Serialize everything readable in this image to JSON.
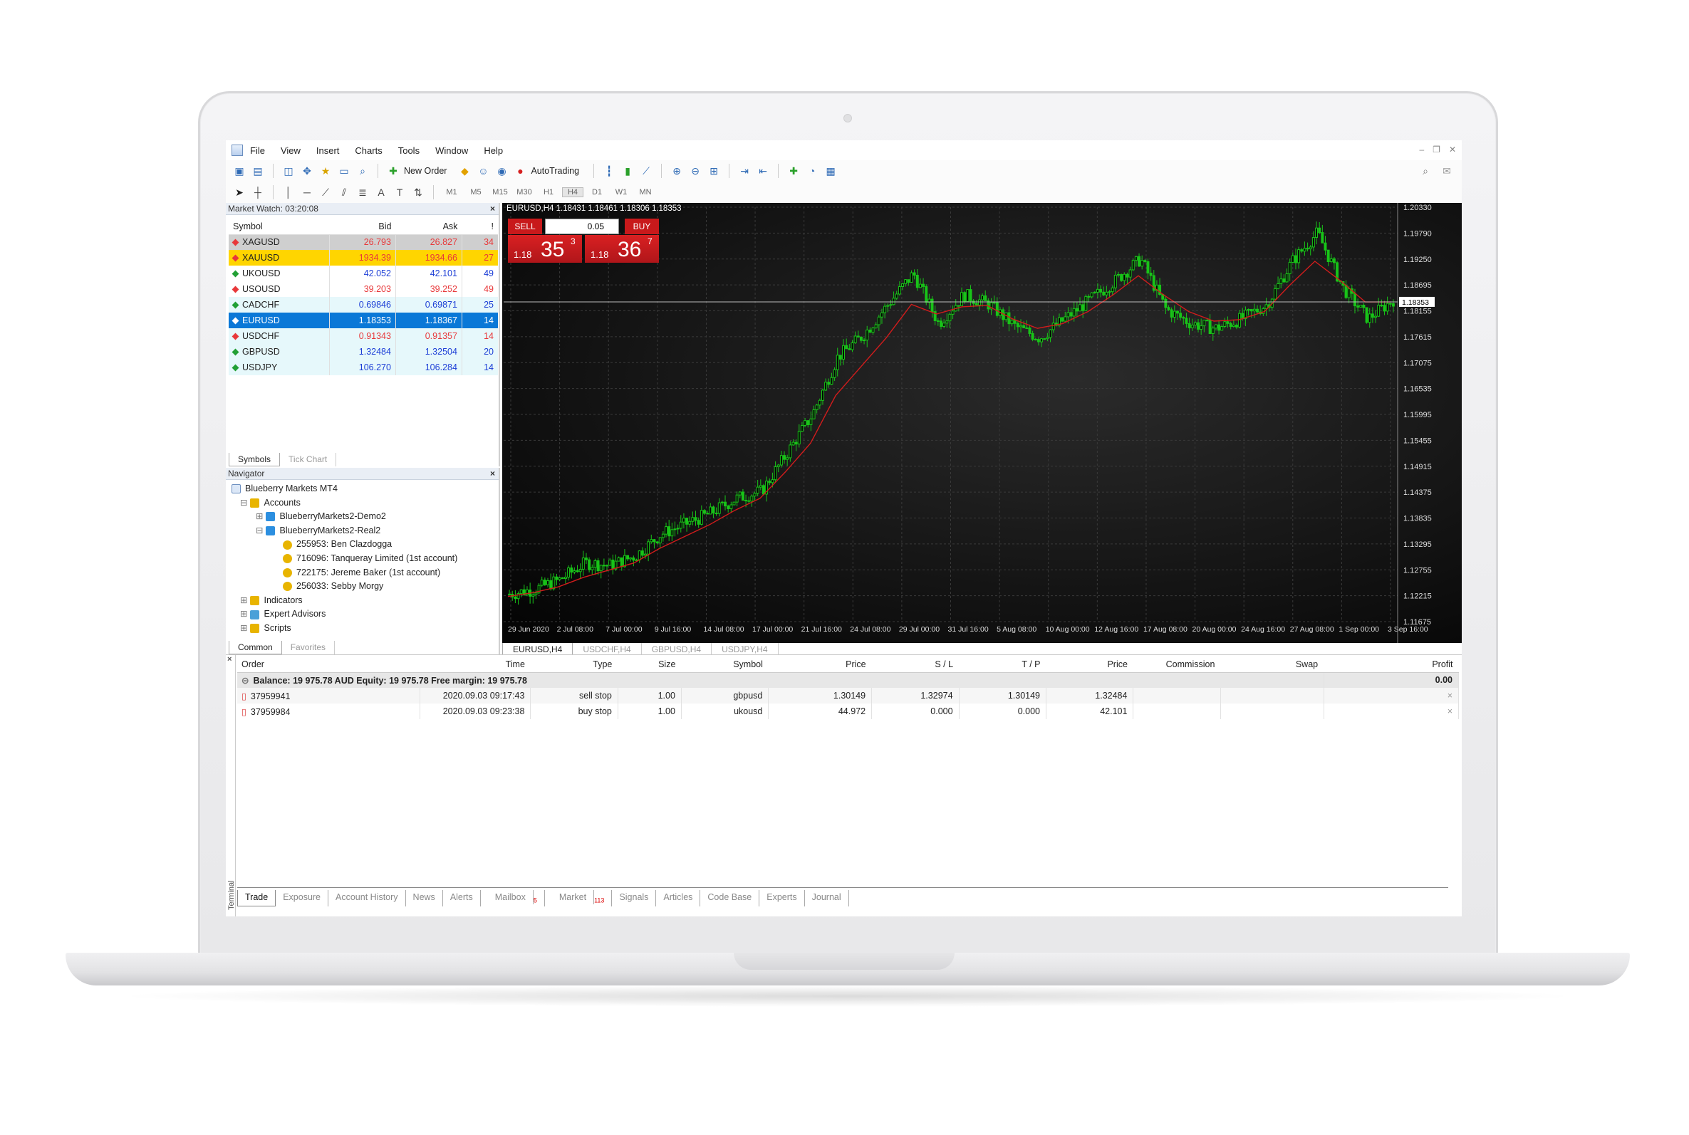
{
  "menu": [
    "File",
    "View",
    "Insert",
    "Charts",
    "Tools",
    "Window",
    "Help"
  ],
  "toolbar": {
    "new_order": "New Order",
    "autotrading": "AutoTrading",
    "timeframes": [
      "M1",
      "M5",
      "M15",
      "M30",
      "H1",
      "H4",
      "D1",
      "W1",
      "MN"
    ],
    "active_timeframe": "H4"
  },
  "market_watch": {
    "title": "Market Watch: 03:20:08",
    "columns": [
      "Symbol",
      "Bid",
      "Ask",
      "!"
    ],
    "rows": [
      {
        "symbol": "XAGUSD",
        "bid": "26.793",
        "ask": "26.827",
        "spread": "34",
        "color": "#e8383a",
        "bg": "#cfcfcf"
      },
      {
        "symbol": "XAUUSD",
        "bid": "1934.39",
        "ask": "1934.66",
        "spread": "27",
        "color": "#e8383a",
        "bg": "#ffd500"
      },
      {
        "symbol": "UKOUSD",
        "bid": "42.052",
        "ask": "42.101",
        "spread": "49",
        "color": "#1c3ed6",
        "bg": "#ffffff"
      },
      {
        "symbol": "USOUSD",
        "bid": "39.203",
        "ask": "39.252",
        "spread": "49",
        "color": "#e8383a",
        "bg": "#ffffff"
      },
      {
        "symbol": "CADCHF",
        "bid": "0.69846",
        "ask": "0.69871",
        "spread": "25",
        "color": "#1c3ed6",
        "bg": "#e6f8fb"
      },
      {
        "symbol": "EURUSD",
        "bid": "1.18353",
        "ask": "1.18367",
        "spread": "14",
        "color": "#ffffff",
        "bg": "#0a78d7"
      },
      {
        "symbol": "USDCHF",
        "bid": "0.91343",
        "ask": "0.91357",
        "spread": "14",
        "color": "#e8383a",
        "bg": "#e6f8fb"
      },
      {
        "symbol": "GBPUSD",
        "bid": "1.32484",
        "ask": "1.32504",
        "spread": "20",
        "color": "#1c3ed6",
        "bg": "#e6f8fb"
      },
      {
        "symbol": "USDJPY",
        "bid": "106.270",
        "ask": "106.284",
        "spread": "14",
        "color": "#1c3ed6",
        "bg": "#e6f8fb"
      }
    ],
    "tabs": [
      "Symbols",
      "Tick Chart"
    ]
  },
  "navigator": {
    "title": "Navigator",
    "root": "Blueberry Markets MT4",
    "accounts": "Accounts",
    "demo": "BlueberryMarkets2-Demo2",
    "real": "BlueberryMarkets2-Real2",
    "users": [
      "255953: Ben Clazdogga",
      "716096: Tanqueray Limited (1st account)",
      "722175: Jereme Baker (1st account)",
      "256033: Sebby Morgy"
    ],
    "indicators": "Indicators",
    "experts": "Expert Advisors",
    "scripts": "Scripts",
    "tabs": [
      "Common",
      "Favorites"
    ]
  },
  "chart": {
    "header": "EURUSD,H4  1.18431 1.18461 1.18306 1.18353",
    "sell": "SELL",
    "buy": "BUY",
    "lot": "0.05",
    "sell_small": "1.18",
    "sell_big": "35",
    "sell_sup": "3",
    "buy_small": "1.18",
    "buy_big": "36",
    "buy_sup": "7",
    "current_price": "1.18353",
    "tabs": [
      "EURUSD,H4",
      "USDCHF,H4",
      "GBPUSD,H4",
      "USDJPY,H4"
    ],
    "colors": {
      "up": "#18c418",
      "ma": "#d11c1c",
      "bg": "#000000",
      "grid": "#3a3a3a"
    }
  },
  "chart_data": {
    "type": "line",
    "title": "EURUSD,H4",
    "x": [
      "29 Jun 2020",
      "2 Jul 08:00",
      "7 Jul 00:00",
      "9 Jul 16:00",
      "14 Jul 08:00",
      "17 Jul 00:00",
      "21 Jul 16:00",
      "24 Jul 08:00",
      "29 Jul 00:00",
      "31 Jul 16:00",
      "5 Aug 08:00",
      "10 Aug 00:00",
      "12 Aug 16:00",
      "17 Aug 08:00",
      "20 Aug 00:00",
      "24 Aug 16:00",
      "27 Aug 08:00",
      "1 Sep 00:00",
      "3 Sep 16:00"
    ],
    "y_ticks": [
      "1.20330",
      "1.19790",
      "1.19250",
      "1.18695",
      "1.18155",
      "1.17615",
      "1.17075",
      "1.16535",
      "1.15995",
      "1.15455",
      "1.14915",
      "1.14375",
      "1.13835",
      "1.13295",
      "1.12755",
      "1.12215",
      "1.11675"
    ],
    "ylim": [
      1.11675,
      1.2033
    ],
    "series": [
      {
        "values": [
          1.1225,
          1.1235,
          1.1255,
          1.129,
          1.1285,
          1.1305,
          1.135,
          1.1372,
          1.1395,
          1.1425,
          1.144,
          1.152,
          1.16,
          1.172,
          1.1765,
          1.183,
          1.1895,
          1.179,
          1.185,
          1.183,
          1.1785,
          1.176,
          1.18,
          1.184,
          1.188,
          1.1925,
          1.182,
          1.179,
          1.178,
          1.18,
          1.183,
          1.192,
          1.198,
          1.1865,
          1.18,
          1.184
        ]
      },
      {
        "values": [
          1.122,
          1.1228,
          1.124,
          1.126,
          1.1275,
          1.129,
          1.132,
          1.1345,
          1.137,
          1.14,
          1.1425,
          1.148,
          1.154,
          1.164,
          1.17,
          1.176,
          1.183,
          1.181,
          1.1825,
          1.1828,
          1.18,
          1.178,
          1.179,
          1.1815,
          1.185,
          1.189,
          1.185,
          1.1815,
          1.1795,
          1.1798,
          1.1815,
          1.187,
          1.192,
          1.188,
          1.1835,
          1.1835
        ]
      }
    ]
  },
  "terminal": {
    "label": "Terminal",
    "columns": [
      "Order",
      "Time",
      "Type",
      "Size",
      "Symbol",
      "Price",
      "S / L",
      "T / P",
      "Price",
      "Commission",
      "Swap",
      "Profit"
    ],
    "balance": "Balance: 19 975.78 AUD  Equity: 19 975.78  Free margin: 19 975.78",
    "balance_profit": "0.00",
    "orders": [
      {
        "order": "37959941",
        "time": "2020.09.03 09:17:43",
        "type": "sell stop",
        "size": "1.00",
        "symbol": "gbpusd",
        "price": "1.30149",
        "sl": "1.32974",
        "tp": "1.30149",
        "cur": "1.32484",
        "commission": "",
        "swap": "",
        "profit": ""
      },
      {
        "order": "37959984",
        "time": "2020.09.03 09:23:38",
        "type": "buy stop",
        "size": "1.00",
        "symbol": "ukousd",
        "price": "44.972",
        "sl": "0.000",
        "tp": "0.000",
        "cur": "42.101",
        "commission": "",
        "swap": "",
        "profit": ""
      }
    ],
    "tabs": [
      "Trade",
      "Exposure",
      "Account History",
      "News",
      "Alerts",
      "Mailbox",
      "Market",
      "Signals",
      "Articles",
      "Code Base",
      "Experts",
      "Journal"
    ],
    "mailbox_count": "5",
    "market_count": "113"
  }
}
